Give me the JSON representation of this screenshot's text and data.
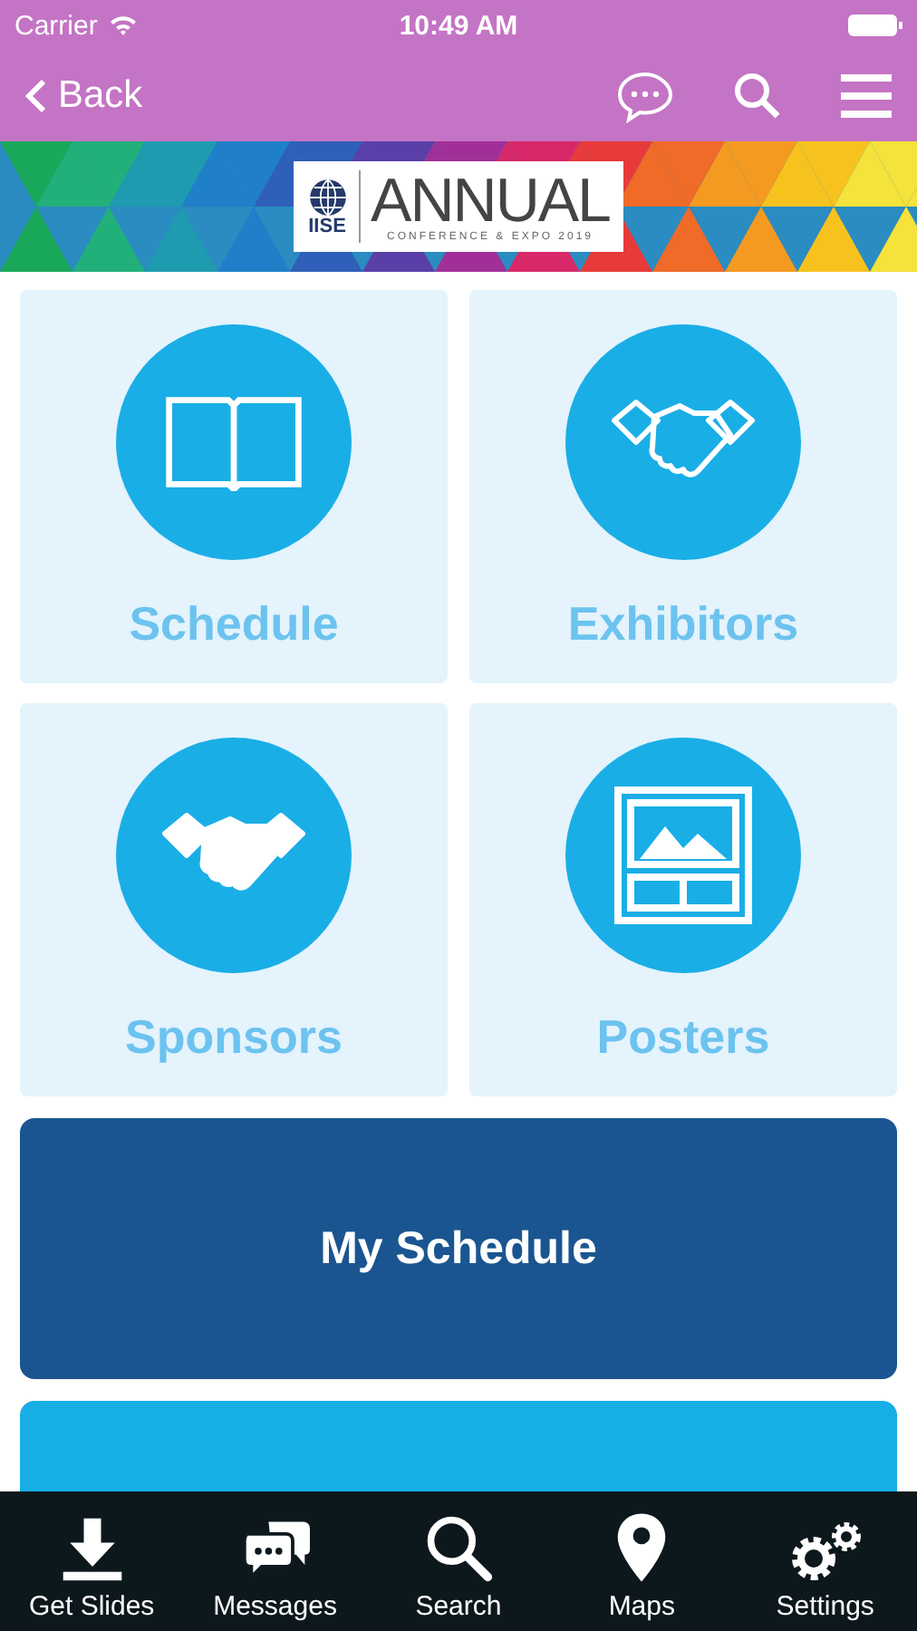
{
  "status_bar": {
    "carrier": "Carrier",
    "time": "10:49 AM"
  },
  "nav_bar": {
    "back": "Back"
  },
  "banner": {
    "org": "IISE",
    "title": "ANNUAL",
    "subtitle": "CONFERENCE & EXPO 2019"
  },
  "tiles": [
    {
      "label": "Schedule",
      "kind": "book"
    },
    {
      "label": "Exhibitors",
      "kind": "handshake"
    },
    {
      "label": "Sponsors",
      "kind": "handshake"
    },
    {
      "label": "Posters",
      "kind": "poster"
    }
  ],
  "my_schedule": "My Schedule",
  "tab_bar": [
    {
      "label": "Get Slides",
      "kind": "download"
    },
    {
      "label": "Messages",
      "kind": "chat"
    },
    {
      "label": "Search",
      "kind": "search"
    },
    {
      "label": "Maps",
      "kind": "pin"
    },
    {
      "label": "Settings",
      "kind": "gears"
    }
  ]
}
